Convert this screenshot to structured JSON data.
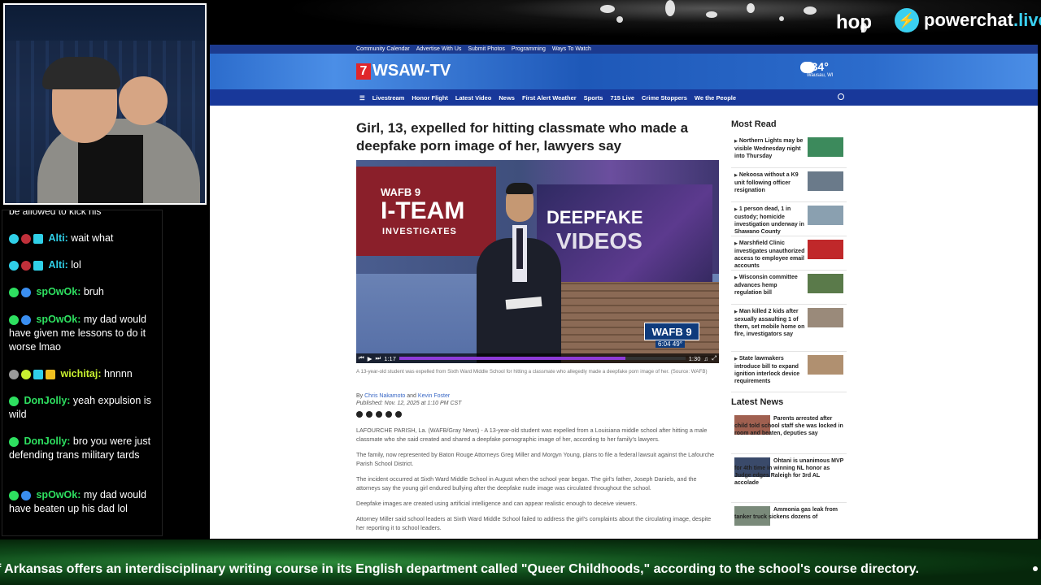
{
  "banner": {
    "hop": "hop",
    "brand_main": "powerchat",
    "brand_suffix": ".live"
  },
  "chat": {
    "partial_top": "be allowed to kick his",
    "messages": [
      {
        "user": "Alti:",
        "text": "wait what",
        "color": "#30d0e8"
      },
      {
        "user": "Alti:",
        "text": "lol",
        "color": "#30d0e8"
      },
      {
        "user": "spOwOk:",
        "text": "bruh",
        "color": "#2ee060"
      },
      {
        "user": "spOwOk:",
        "text": "my dad would have given me lessons to do it worse lmao",
        "color": "#2ee060"
      },
      {
        "user": "wichitaj:",
        "text": "hnnnn",
        "color": "#c8f030"
      },
      {
        "user": "DonJolly:",
        "text": "yeah expulsion is wild",
        "color": "#2ee060"
      },
      {
        "user": "DonJolly:",
        "text": "bro you were just defending trans military tards",
        "color": "#2ee060"
      },
      {
        "user": "spOwOk:",
        "text": "my dad would have beaten up his dad lol",
        "color": "#2ee060"
      }
    ]
  },
  "site": {
    "util_links": [
      "Community Calendar",
      "Advertise With Us",
      "Submit Photos",
      "Programming",
      "Ways To Watch"
    ],
    "logo_7": "7",
    "logo_text": "WSAW-TV",
    "weather_temp": "34°",
    "weather_loc": "Wausau, WI",
    "nav": [
      "Livestream",
      "Honor Flight",
      "Latest Video",
      "News",
      "First Alert Weather",
      "Sports",
      "715 Live",
      "Crime Stoppers",
      "We the People"
    ],
    "headline": "Girl, 13, expelled for hitting classmate who made a deepfake porn image of her, lawyers say",
    "video": {
      "wafb": "WAFB 9",
      "iteam": "I-TEAM",
      "investigates": "INVESTIGATES",
      "deepfake": "DEEPFAKE",
      "videos": "VIDEOS",
      "bug": "WAFB 9",
      "clock": "6:04  49°",
      "time_current": "1:17",
      "time_total": "1:30",
      "progress": 0.79
    },
    "caption": "A 13-year-old student was expelled from Sixth Ward Middle School for hitting a classmate who allegedly made a deepfake porn image of her. (Source: WAFB)",
    "byline_prefix": "By",
    "author1": "Chris Nakamoto",
    "byline_and": "and",
    "author2": "Kevin Foster",
    "published": "Published: Nov. 12, 2025 at 1:10 PM CST",
    "paragraphs": [
      "LAFOURCHE PARISH, La. (WAFB/Gray News) - A 13-year-old student was expelled from a Louisiana middle school after hitting a male classmate who she said created and shared a deepfake pornographic image of her, according to her family's lawyers.",
      "The family, now represented by Baton Rouge Attorneys Greg Miller and Morgyn Young, plans to file a federal lawsuit against the Lafourche Parish School District.",
      "The incident occurred at Sixth Ward Middle School in August when the school year began. The girl's father, Joseph Daniels, and the attorneys say the young girl endured bullying after the deepfake nude image was circulated throughout the school.",
      "Deepfake images are created using artificial intelligence and can appear realistic enough to deceive viewers.",
      "Attorney Miller said school leaders at Sixth Ward Middle School failed to address the girl's complaints about the circulating image, despite her reporting it to school leaders."
    ],
    "most_read_title": "Most Read",
    "most_read": [
      "Northern Lights may be visible Wednesday night into Thursday",
      "Nekoosa without a K9 unit following officer resignation",
      "1 person dead, 1 in custody; homicide investigation underway in Shawano County",
      "Marshfield Clinic investigates unauthorized access to employee email accounts",
      "Wisconsin committee advances hemp regulation bill",
      "Man killed 2 kids after sexually assaulting 1 of them, set mobile home on fire, investigators say",
      "State lawmakers introduce bill to expand ignition interlock device requirements"
    ],
    "latest_title": "Latest News",
    "latest": [
      "Parents arrested after child told school staff she was locked in room and beaten, deputies say",
      "Ohtani is unanimous MVP for 4th time in winning NL honor as Judge edges Raleigh for 3rd AL accolade",
      "Ammonia gas leak from tanker truck sickens dozens of"
    ]
  },
  "ticker": {
    "text": "f Arkansas offers an interdisciplinary writing course in its English department called \"Queer Childhoods,\" according to the school's course directory."
  }
}
